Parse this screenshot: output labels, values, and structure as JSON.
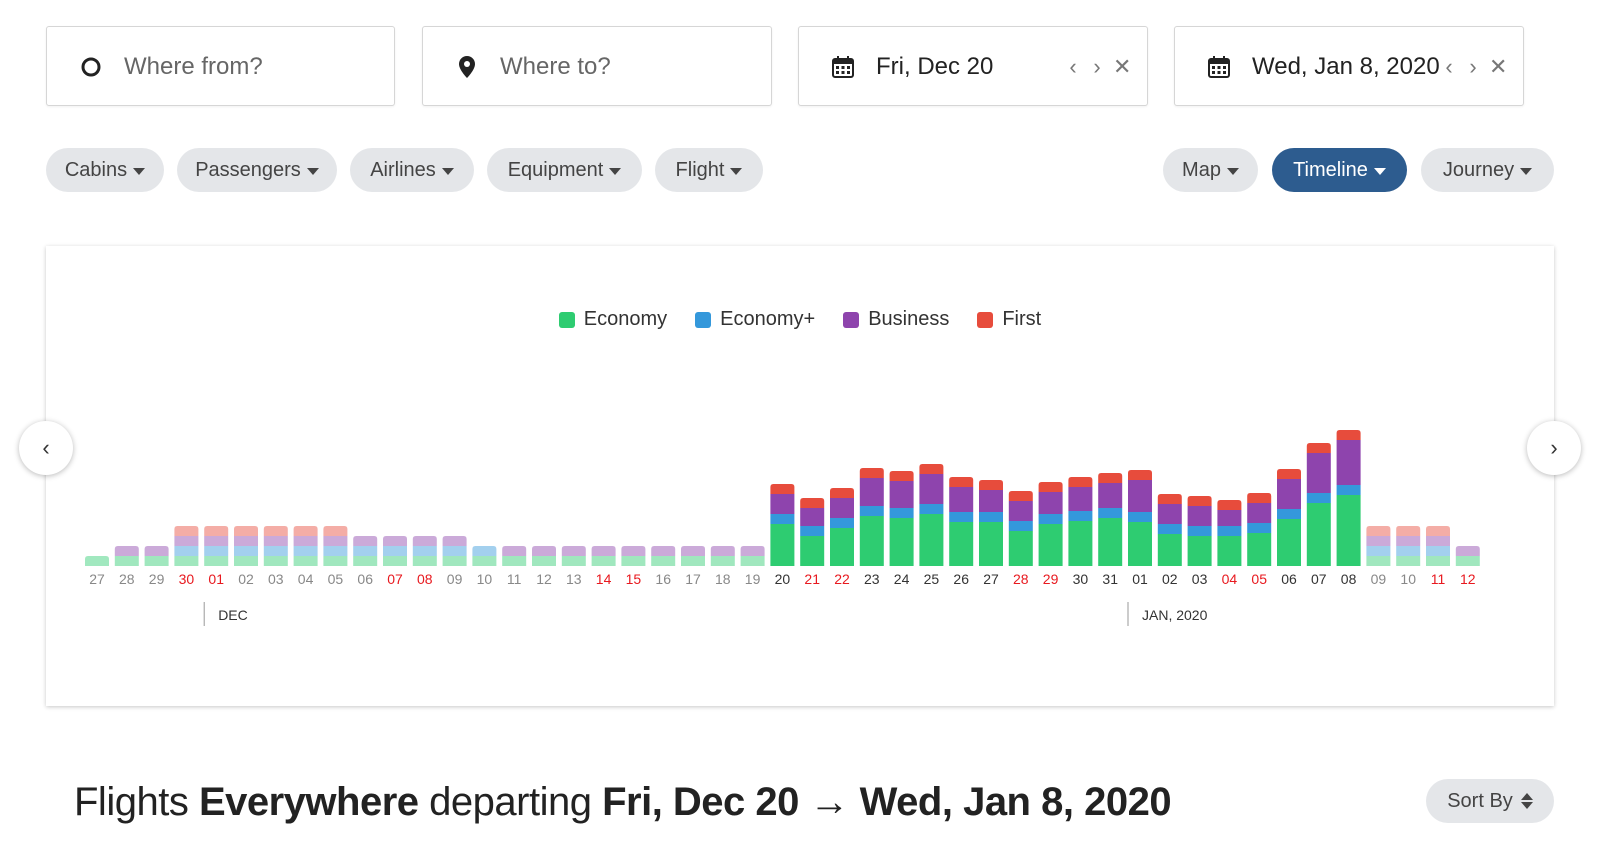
{
  "search": {
    "from_placeholder": "Where from?",
    "to_placeholder": "Where to?",
    "depart_date": "Fri, Dec 20",
    "return_date": "Wed, Jan 8, 2020"
  },
  "filters": {
    "left": [
      "Cabins",
      "Passengers",
      "Airlines",
      "Equipment",
      "Flight"
    ],
    "view": [
      "Map",
      "Timeline",
      "Journey"
    ],
    "active_view": "Timeline"
  },
  "colors": {
    "economy": "#2ecc71",
    "economy_plus": "#3498db",
    "business": "#8e44ad",
    "first": "#e74c3c",
    "weekend_tick": "#e8191f",
    "tick": "#888888",
    "accent": "#2d5c8f"
  },
  "chart_data": {
    "type": "bar",
    "stacked": true,
    "legend": [
      "Economy",
      "Economy+",
      "Business",
      "First"
    ],
    "legend_position": "top-center",
    "categories": [
      "27",
      "28",
      "29",
      "30",
      "01",
      "02",
      "03",
      "04",
      "05",
      "06",
      "07",
      "08",
      "09",
      "10",
      "11",
      "12",
      "13",
      "14",
      "15",
      "16",
      "17",
      "18",
      "19",
      "20",
      "21",
      "22",
      "23",
      "24",
      "25",
      "26",
      "27",
      "28",
      "29",
      "30",
      "31",
      "01",
      "02",
      "03",
      "04",
      "05",
      "06",
      "07",
      "08",
      "09",
      "10",
      "11",
      "12"
    ],
    "weekend_indices": [
      3,
      4,
      10,
      11,
      17,
      18,
      24,
      25,
      31,
      32,
      38,
      39,
      45,
      46
    ],
    "active_range": [
      23,
      42
    ],
    "series": [
      {
        "name": "Economy",
        "values": [
          10,
          10,
          10,
          10,
          10,
          10,
          10,
          10,
          10,
          10,
          10,
          10,
          10,
          10,
          10,
          10,
          10,
          10,
          10,
          10,
          10,
          10,
          10,
          42,
          30,
          38,
          50,
          48,
          52,
          44,
          44,
          35,
          42,
          45,
          48,
          44,
          32,
          30,
          30,
          33,
          47,
          63,
          71,
          10,
          10,
          10,
          10
        ]
      },
      {
        "name": "Economy+",
        "values": [
          0,
          0,
          0,
          10,
          10,
          10,
          10,
          10,
          10,
          10,
          10,
          10,
          10,
          10,
          0,
          0,
          0,
          0,
          0,
          0,
          0,
          0,
          0,
          10,
          10,
          10,
          10,
          10,
          10,
          10,
          10,
          10,
          10,
          10,
          10,
          10,
          10,
          10,
          10,
          10,
          10,
          10,
          10,
          10,
          10,
          10,
          0
        ]
      },
      {
        "name": "Business",
        "values": [
          0,
          10,
          10,
          10,
          10,
          10,
          10,
          10,
          10,
          10,
          10,
          10,
          10,
          0,
          10,
          10,
          10,
          10,
          10,
          10,
          10,
          10,
          10,
          20,
          18,
          20,
          28,
          27,
          30,
          25,
          22,
          20,
          22,
          24,
          25,
          32,
          20,
          20,
          16,
          20,
          30,
          40,
          45,
          10,
          10,
          10,
          10
        ]
      },
      {
        "name": "First",
        "values": [
          0,
          0,
          0,
          10,
          10,
          10,
          10,
          10,
          10,
          0,
          0,
          0,
          0,
          0,
          0,
          0,
          0,
          0,
          0,
          0,
          0,
          0,
          0,
          10,
          10,
          10,
          10,
          10,
          10,
          10,
          10,
          10,
          10,
          10,
          10,
          10,
          10,
          10,
          10,
          10,
          10,
          10,
          10,
          10,
          10,
          10,
          0
        ]
      }
    ],
    "month_markers": [
      {
        "index": 4,
        "label": "DEC"
      },
      {
        "index": 35,
        "label": "JAN, 2020"
      }
    ]
  },
  "results": {
    "prefix": "Flights",
    "place": "Everywhere",
    "middle": "departing",
    "range": "Fri, Dec 20 → Wed, Jan 8, 2020"
  },
  "sort_label": "Sort By"
}
